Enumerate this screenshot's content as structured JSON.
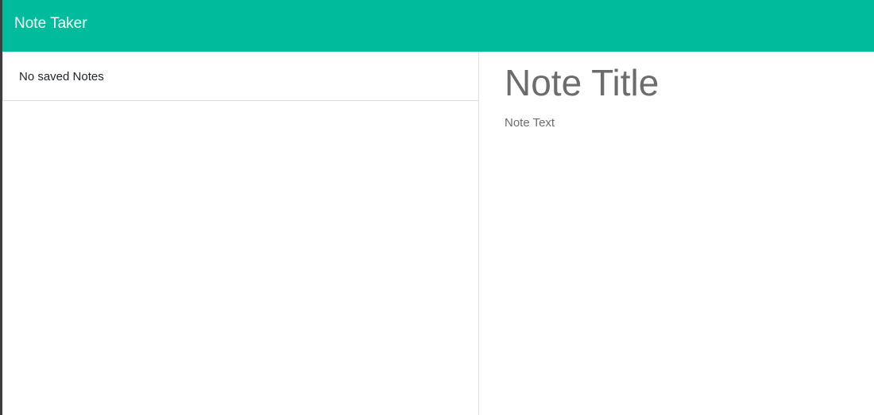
{
  "navbar": {
    "brand": "Note Taker",
    "background_color": "#00bc9c"
  },
  "notes_list": {
    "empty_message": "No saved Notes"
  },
  "editor": {
    "title_placeholder": "Note Title",
    "text_placeholder": "Note Text",
    "title_value": "",
    "text_value": ""
  }
}
